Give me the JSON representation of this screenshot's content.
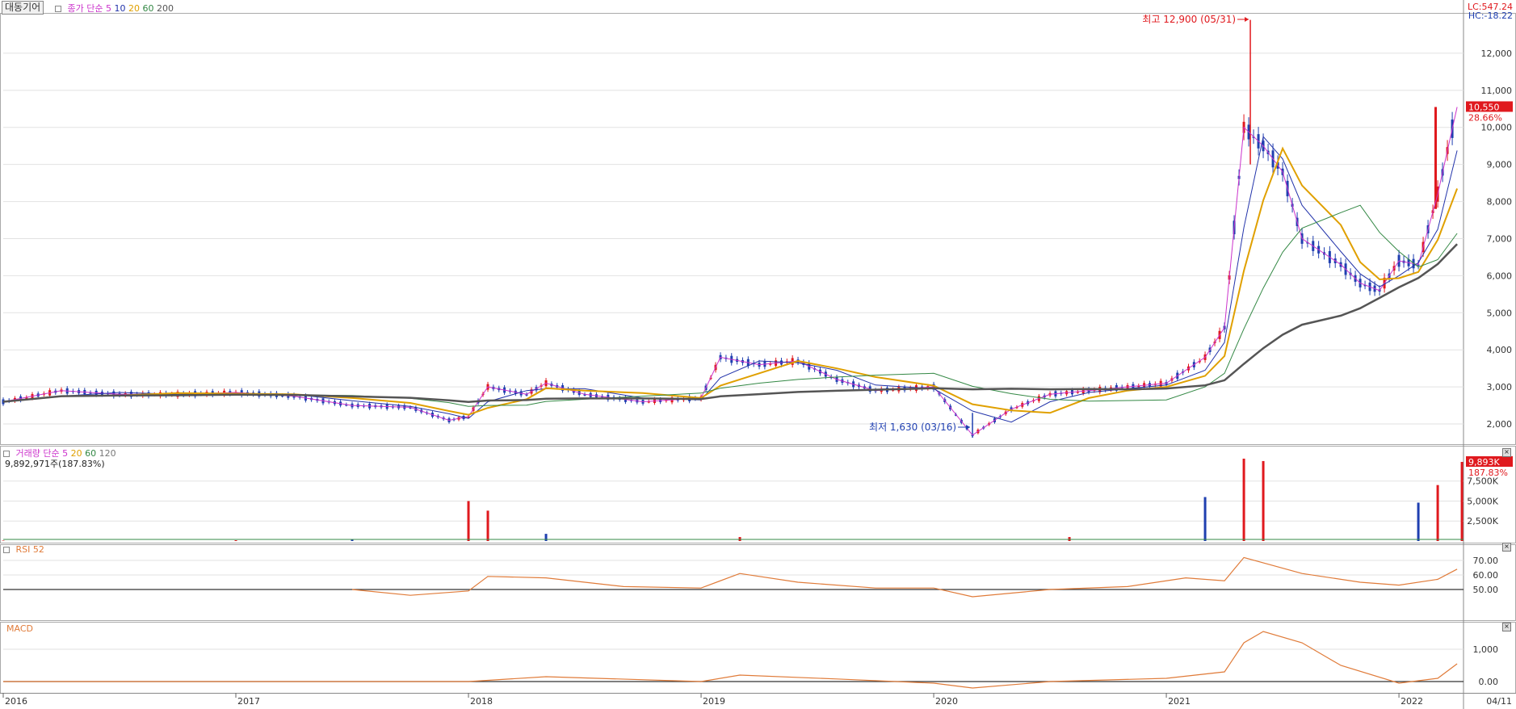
{
  "header": {
    "stock_name": "대동기어",
    "price_label": "종가",
    "ma_label": "단순",
    "ma_periods": [
      "5",
      "10",
      "20",
      "60",
      "200"
    ],
    "ma_colors": [
      "#cc33cc",
      "#2233aa",
      "#e0a000",
      "#338844",
      "#555555"
    ]
  },
  "top_right": {
    "lc": "LC:547.24",
    "hc": "HC:-18.22"
  },
  "price_panel": {
    "current_price": "10,550",
    "current_change": "28.66%",
    "y_ticks": [
      "12,000",
      "11,000",
      "10,000",
      "9,000",
      "8,000",
      "7,000",
      "6,000",
      "5,000",
      "4,000",
      "3,000",
      "2,000"
    ],
    "high_note": "최고 12,900 (05/31)",
    "low_note": "최저 1,630 (03/16)"
  },
  "volume_panel": {
    "label": "거래량",
    "ma_label": "단순",
    "ma_periods": [
      "5",
      "20",
      "60",
      "120"
    ],
    "ma_colors": [
      "#cc33cc",
      "#e0a000",
      "#338844",
      "#777777"
    ],
    "current_volume": "9,892,971주(187.83%)",
    "badge_value": "9,893K",
    "badge_change": "187.83%",
    "y_ticks": [
      "7,500K",
      "5,000K",
      "2,500K"
    ]
  },
  "rsi_panel": {
    "label": "RSI 52",
    "y_ticks": [
      "70.00",
      "60.00",
      "50.00"
    ]
  },
  "macd_panel": {
    "label": "MACD",
    "y_ticks": [
      "1,000",
      "0.00"
    ]
  },
  "x_axis": {
    "labels": [
      "2016",
      "2017",
      "2018",
      "2019",
      "2020",
      "2021",
      "2022"
    ],
    "end_label": "04/11"
  },
  "colors": {
    "up": "#e0191e",
    "down": "#1f3fb0",
    "rsi": "#e07b39",
    "macd": "#e07b39",
    "price_badge": "#e0191e"
  },
  "chart_data": [
    {
      "type": "line",
      "title": "대동기어",
      "x": [
        "2016-01",
        "2016-04",
        "2016-07",
        "2016-10",
        "2017-01",
        "2017-04",
        "2017-07",
        "2017-10",
        "2017-12",
        "2018-01",
        "2018-02",
        "2018-04",
        "2018-05",
        "2018-07",
        "2018-10",
        "2019-01",
        "2019-02",
        "2019-04",
        "2019-06",
        "2019-08",
        "2019-10",
        "2020-01",
        "2020-03",
        "2020-05",
        "2020-07",
        "2020-09",
        "2020-11",
        "2021-01",
        "2021-03",
        "2021-04",
        "2021-05",
        "2021-06",
        "2021-07",
        "2021-08",
        "2021-10",
        "2021-11",
        "2021-12",
        "2022-01",
        "2022-02",
        "2022-03",
        "2022-04"
      ],
      "series": [
        {
          "values": [
            2600,
            2900,
            2800,
            2800,
            2850,
            2750,
            2500,
            2450,
            2100,
            2200,
            3000,
            2800,
            3100,
            2800,
            2600,
            2700,
            3800,
            3600,
            3700,
            3200,
            2900,
            3000,
            1700,
            2400,
            2800,
            2900,
            3000,
            3100,
            3800,
            4600,
            10000,
            9500,
            8800,
            7000,
            6300,
            5800,
            5600,
            6400,
            6300,
            8200,
            10550
          ]
        }
      ],
      "ylim": [
        1500,
        13000
      ],
      "xlabel": "",
      "ylabel": ""
    },
    {
      "type": "bar",
      "title": "거래량",
      "x": [
        "2016-01",
        "2017-01",
        "2017-07",
        "2018-01",
        "2018-02",
        "2018-05",
        "2019-03",
        "2020-08",
        "2021-03",
        "2021-05",
        "2021-06",
        "2022-02",
        "2022-03",
        "2022-04"
      ],
      "values": [
        50,
        100,
        200,
        5000,
        3800,
        900,
        500,
        500,
        5500,
        10300,
        10000,
        4800,
        7000,
        9893
      ],
      "ylim": [
        0,
        10500
      ],
      "xlabel": "",
      "ylabel": ""
    },
    {
      "type": "line",
      "title": "RSI 52",
      "x": [
        "2017-07",
        "2017-10",
        "2018-01",
        "2018-02",
        "2018-05",
        "2018-09",
        "2019-01",
        "2019-03",
        "2019-06",
        "2019-10",
        "2020-01",
        "2020-03",
        "2020-07",
        "2020-11",
        "2021-02",
        "2021-04",
        "2021-05",
        "2021-08",
        "2021-11",
        "2022-01",
        "2022-03",
        "2022-04"
      ],
      "values": [
        50,
        46,
        49,
        59,
        58,
        52,
        51,
        61,
        55,
        51,
        51,
        45,
        50,
        52,
        58,
        56,
        72,
        61,
        55,
        53,
        57,
        64
      ],
      "ylim": [
        30,
        80
      ],
      "xlabel": "",
      "ylabel": ""
    },
    {
      "type": "line",
      "title": "MACD",
      "x": [
        "2016-01",
        "2017-01",
        "2018-01",
        "2018-05",
        "2019-01",
        "2019-03",
        "2019-08",
        "2020-01",
        "2020-03",
        "2020-07",
        "2021-01",
        "2021-04",
        "2021-05",
        "2021-06",
        "2021-08",
        "2021-10",
        "2022-01",
        "2022-03",
        "2022-04"
      ],
      "values": [
        0,
        0,
        0,
        150,
        0,
        200,
        80,
        -50,
        -200,
        0,
        100,
        300,
        1200,
        1550,
        1200,
        500,
        -50,
        100,
        550
      ],
      "ylim": [
        -300,
        1800
      ],
      "xlabel": "",
      "ylabel": ""
    }
  ]
}
